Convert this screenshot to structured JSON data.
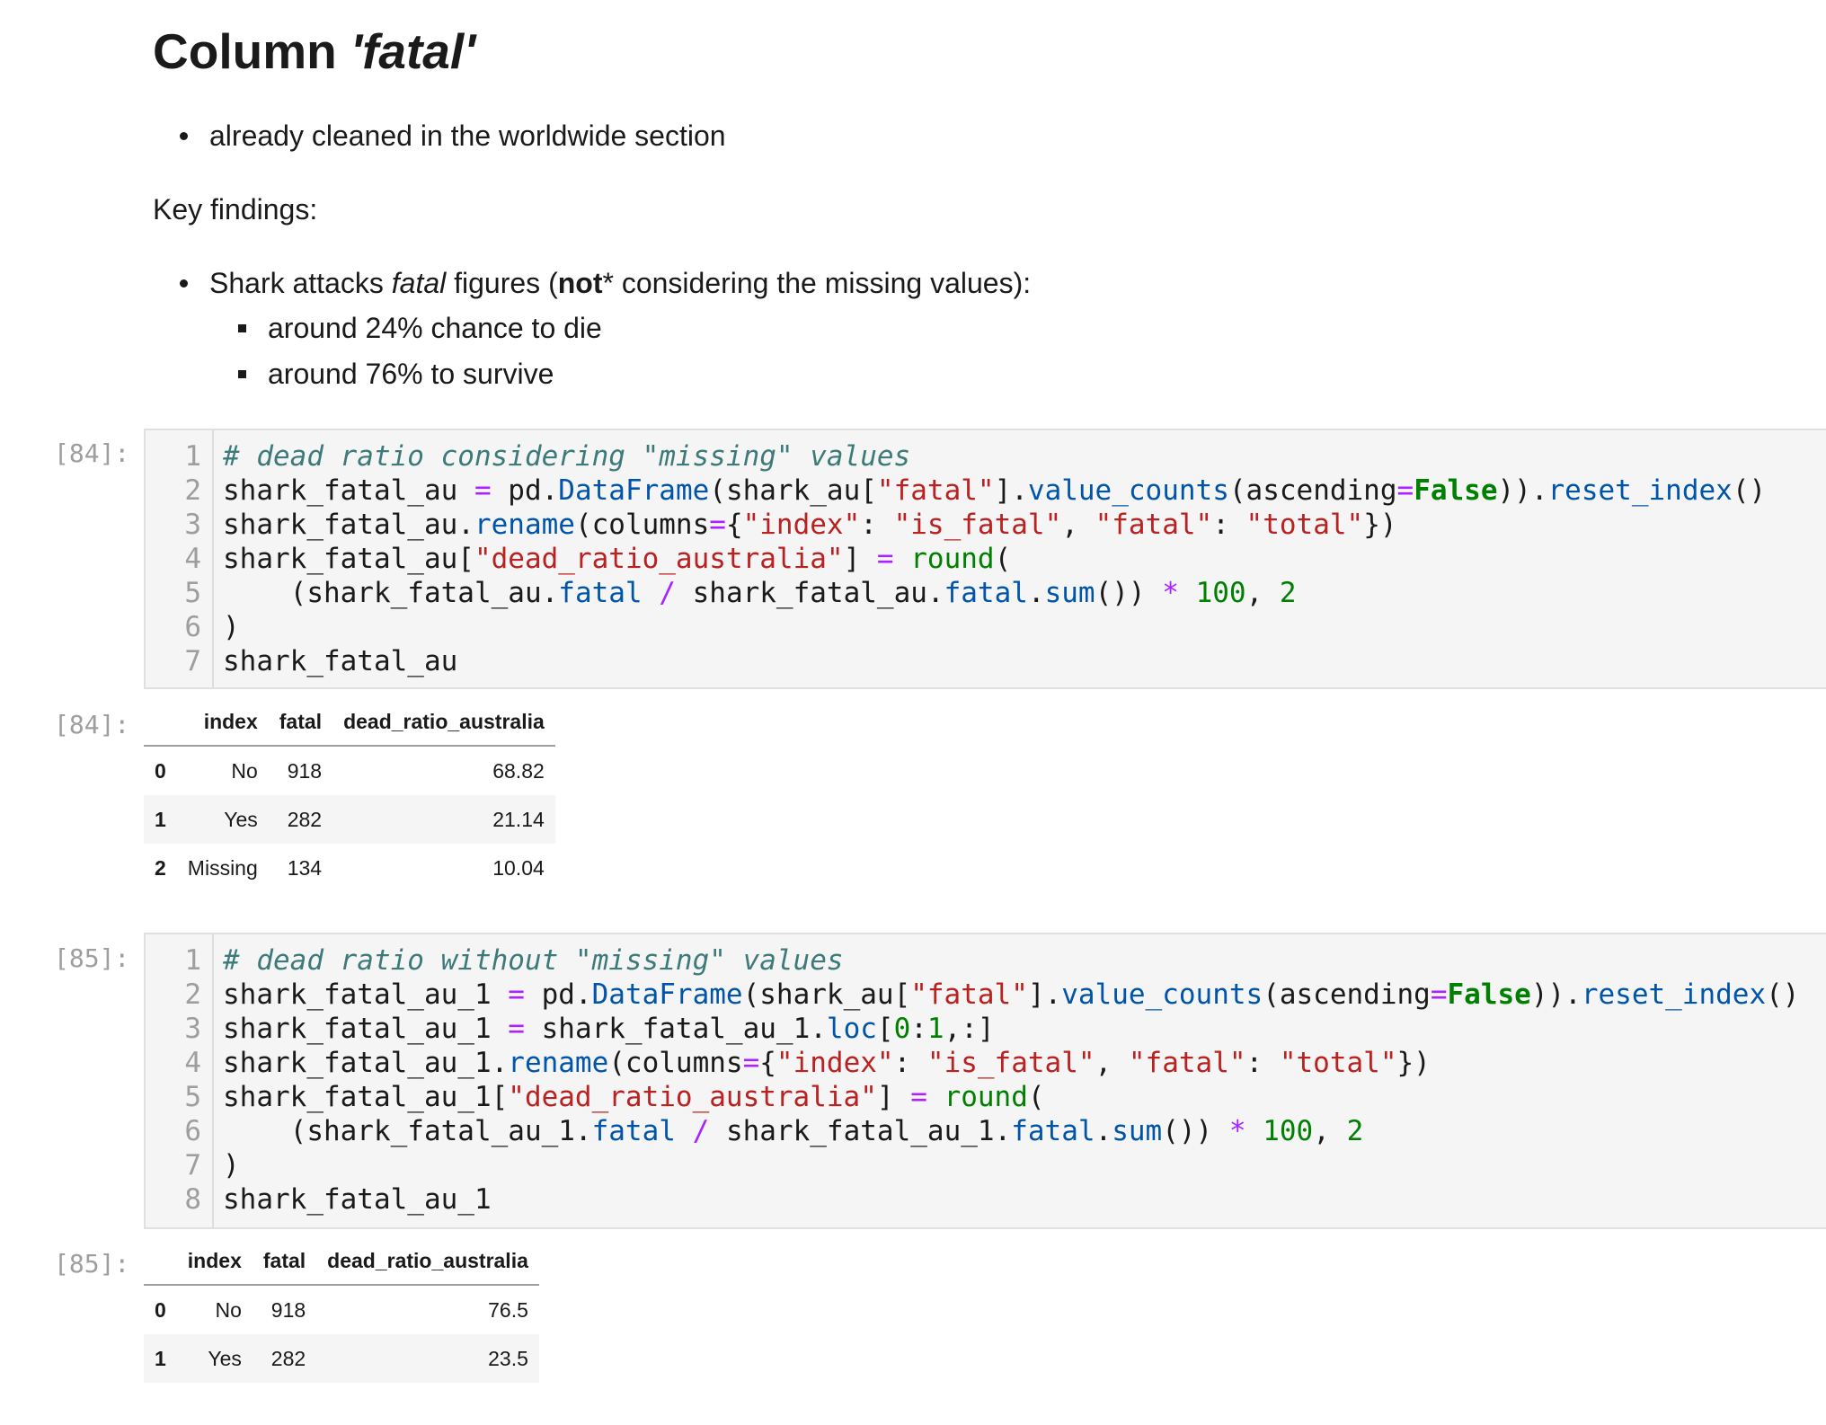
{
  "markdown": {
    "title_prefix": "Column ",
    "title_em": "'fatal'",
    "bullet1": "already cleaned in the worldwide section",
    "key_findings": "Key findings:",
    "bullet2_a": "Shark attacks ",
    "bullet2_em": "fatal",
    "bullet2_b": " figures (",
    "bullet2_bold": "not",
    "bullet2_c": "* considering the missing values):",
    "sub1": "around 24% chance to die",
    "sub2": "around 76% to survive"
  },
  "cells": [
    {
      "prompt_in": "[84]:",
      "prompt_out": "[84]:",
      "line_numbers": [
        "1",
        "2",
        "3",
        "4",
        "5",
        "6",
        "7"
      ],
      "table": {
        "columns": [
          "",
          "index",
          "fatal",
          "dead_ratio_australia"
        ],
        "rows": [
          [
            "0",
            "No",
            "918",
            "68.82"
          ],
          [
            "1",
            "Yes",
            "282",
            "21.14"
          ],
          [
            "2",
            "Missing",
            "134",
            "10.04"
          ]
        ]
      }
    },
    {
      "prompt_in": "[85]:",
      "prompt_out": "[85]:",
      "line_numbers": [
        "1",
        "2",
        "3",
        "4",
        "5",
        "6",
        "7",
        "8"
      ],
      "table": {
        "columns": [
          "",
          "index",
          "fatal",
          "dead_ratio_australia"
        ],
        "rows": [
          [
            "0",
            "No",
            "918",
            "76.5"
          ],
          [
            "1",
            "Yes",
            "282",
            "23.5"
          ]
        ]
      }
    }
  ],
  "code1": [
    [
      [
        "cm",
        "# dead ratio considering \"missing\" values"
      ]
    ],
    [
      [
        "",
        "shark_fatal_au "
      ],
      [
        "op",
        "="
      ],
      [
        "",
        " pd."
      ],
      [
        "fn",
        "DataFrame"
      ],
      [
        "",
        "(shark_au["
      ],
      [
        "st",
        "\"fatal\""
      ],
      [
        "",
        "]."
      ],
      [
        "fn",
        "value_counts"
      ],
      [
        "",
        "(ascending"
      ],
      [
        "op",
        "="
      ],
      [
        "kw",
        "False"
      ],
      [
        "",
        "))."
      ],
      [
        "fn",
        "reset_index"
      ],
      [
        "",
        "()"
      ]
    ],
    [
      [
        "",
        "shark_fatal_au."
      ],
      [
        "fn",
        "rename"
      ],
      [
        "",
        "(columns"
      ],
      [
        "op",
        "="
      ],
      [
        "",
        "{"
      ],
      [
        "st",
        "\"index\""
      ],
      [
        "",
        ": "
      ],
      [
        "st",
        "\"is_fatal\""
      ],
      [
        "",
        ", "
      ],
      [
        "st",
        "\"fatal\""
      ],
      [
        "",
        ": "
      ],
      [
        "st",
        "\"total\""
      ],
      [
        "",
        "})"
      ]
    ],
    [
      [
        "",
        "shark_fatal_au["
      ],
      [
        "st",
        "\"dead_ratio_australia\""
      ],
      [
        "",
        "] "
      ],
      [
        "op",
        "="
      ],
      [
        "",
        " "
      ],
      [
        "nu",
        "round"
      ],
      [
        "",
        "("
      ]
    ],
    [
      [
        "",
        "    (shark_fatal_au."
      ],
      [
        "fn",
        "fatal"
      ],
      [
        "",
        " "
      ],
      [
        "op",
        "/"
      ],
      [
        "",
        " shark_fatal_au."
      ],
      [
        "fn",
        "fatal"
      ],
      [
        "",
        "."
      ],
      [
        "fn",
        "sum"
      ],
      [
        "",
        "()) "
      ],
      [
        "op",
        "*"
      ],
      [
        "",
        " "
      ],
      [
        "nu",
        "100"
      ],
      [
        "",
        ", "
      ],
      [
        "nu",
        "2"
      ]
    ],
    [
      [
        "",
        ")"
      ]
    ],
    [
      [
        "",
        "shark_fatal_au"
      ]
    ]
  ],
  "code2": [
    [
      [
        "cm",
        "# dead ratio without \"missing\" values"
      ]
    ],
    [
      [
        "",
        "shark_fatal_au_1 "
      ],
      [
        "op",
        "="
      ],
      [
        "",
        " pd."
      ],
      [
        "fn",
        "DataFrame"
      ],
      [
        "",
        "(shark_au["
      ],
      [
        "st",
        "\"fatal\""
      ],
      [
        "",
        "]."
      ],
      [
        "fn",
        "value_counts"
      ],
      [
        "",
        "(ascending"
      ],
      [
        "op",
        "="
      ],
      [
        "kw",
        "False"
      ],
      [
        "",
        "))."
      ],
      [
        "fn",
        "reset_index"
      ],
      [
        "",
        "()"
      ]
    ],
    [
      [
        "",
        "shark_fatal_au_1 "
      ],
      [
        "op",
        "="
      ],
      [
        "",
        " shark_fatal_au_1."
      ],
      [
        "fn",
        "loc"
      ],
      [
        "",
        "["
      ],
      [
        "nu",
        "0"
      ],
      [
        "",
        ":"
      ],
      [
        "nu",
        "1"
      ],
      [
        "",
        ",:]"
      ]
    ],
    [
      [
        "",
        "shark_fatal_au_1."
      ],
      [
        "fn",
        "rename"
      ],
      [
        "",
        "(columns"
      ],
      [
        "op",
        "="
      ],
      [
        "",
        "{"
      ],
      [
        "st",
        "\"index\""
      ],
      [
        "",
        ": "
      ],
      [
        "st",
        "\"is_fatal\""
      ],
      [
        "",
        ", "
      ],
      [
        "st",
        "\"fatal\""
      ],
      [
        "",
        ": "
      ],
      [
        "st",
        "\"total\""
      ],
      [
        "",
        "})"
      ]
    ],
    [
      [
        "",
        "shark_fatal_au_1["
      ],
      [
        "st",
        "\"dead_ratio_australia\""
      ],
      [
        "",
        "] "
      ],
      [
        "op",
        "="
      ],
      [
        "",
        " "
      ],
      [
        "nu",
        "round"
      ],
      [
        "",
        "("
      ]
    ],
    [
      [
        "",
        "    (shark_fatal_au_1."
      ],
      [
        "fn",
        "fatal"
      ],
      [
        "",
        " "
      ],
      [
        "op",
        "/"
      ],
      [
        "",
        " shark_fatal_au_1."
      ],
      [
        "fn",
        "fatal"
      ],
      [
        "",
        "."
      ],
      [
        "fn",
        "sum"
      ],
      [
        "",
        "()) "
      ],
      [
        "op",
        "*"
      ],
      [
        "",
        " "
      ],
      [
        "nu",
        "100"
      ],
      [
        "",
        ", "
      ],
      [
        "nu",
        "2"
      ]
    ],
    [
      [
        "",
        ")"
      ]
    ],
    [
      [
        "",
        "shark_fatal_au_1"
      ]
    ]
  ]
}
